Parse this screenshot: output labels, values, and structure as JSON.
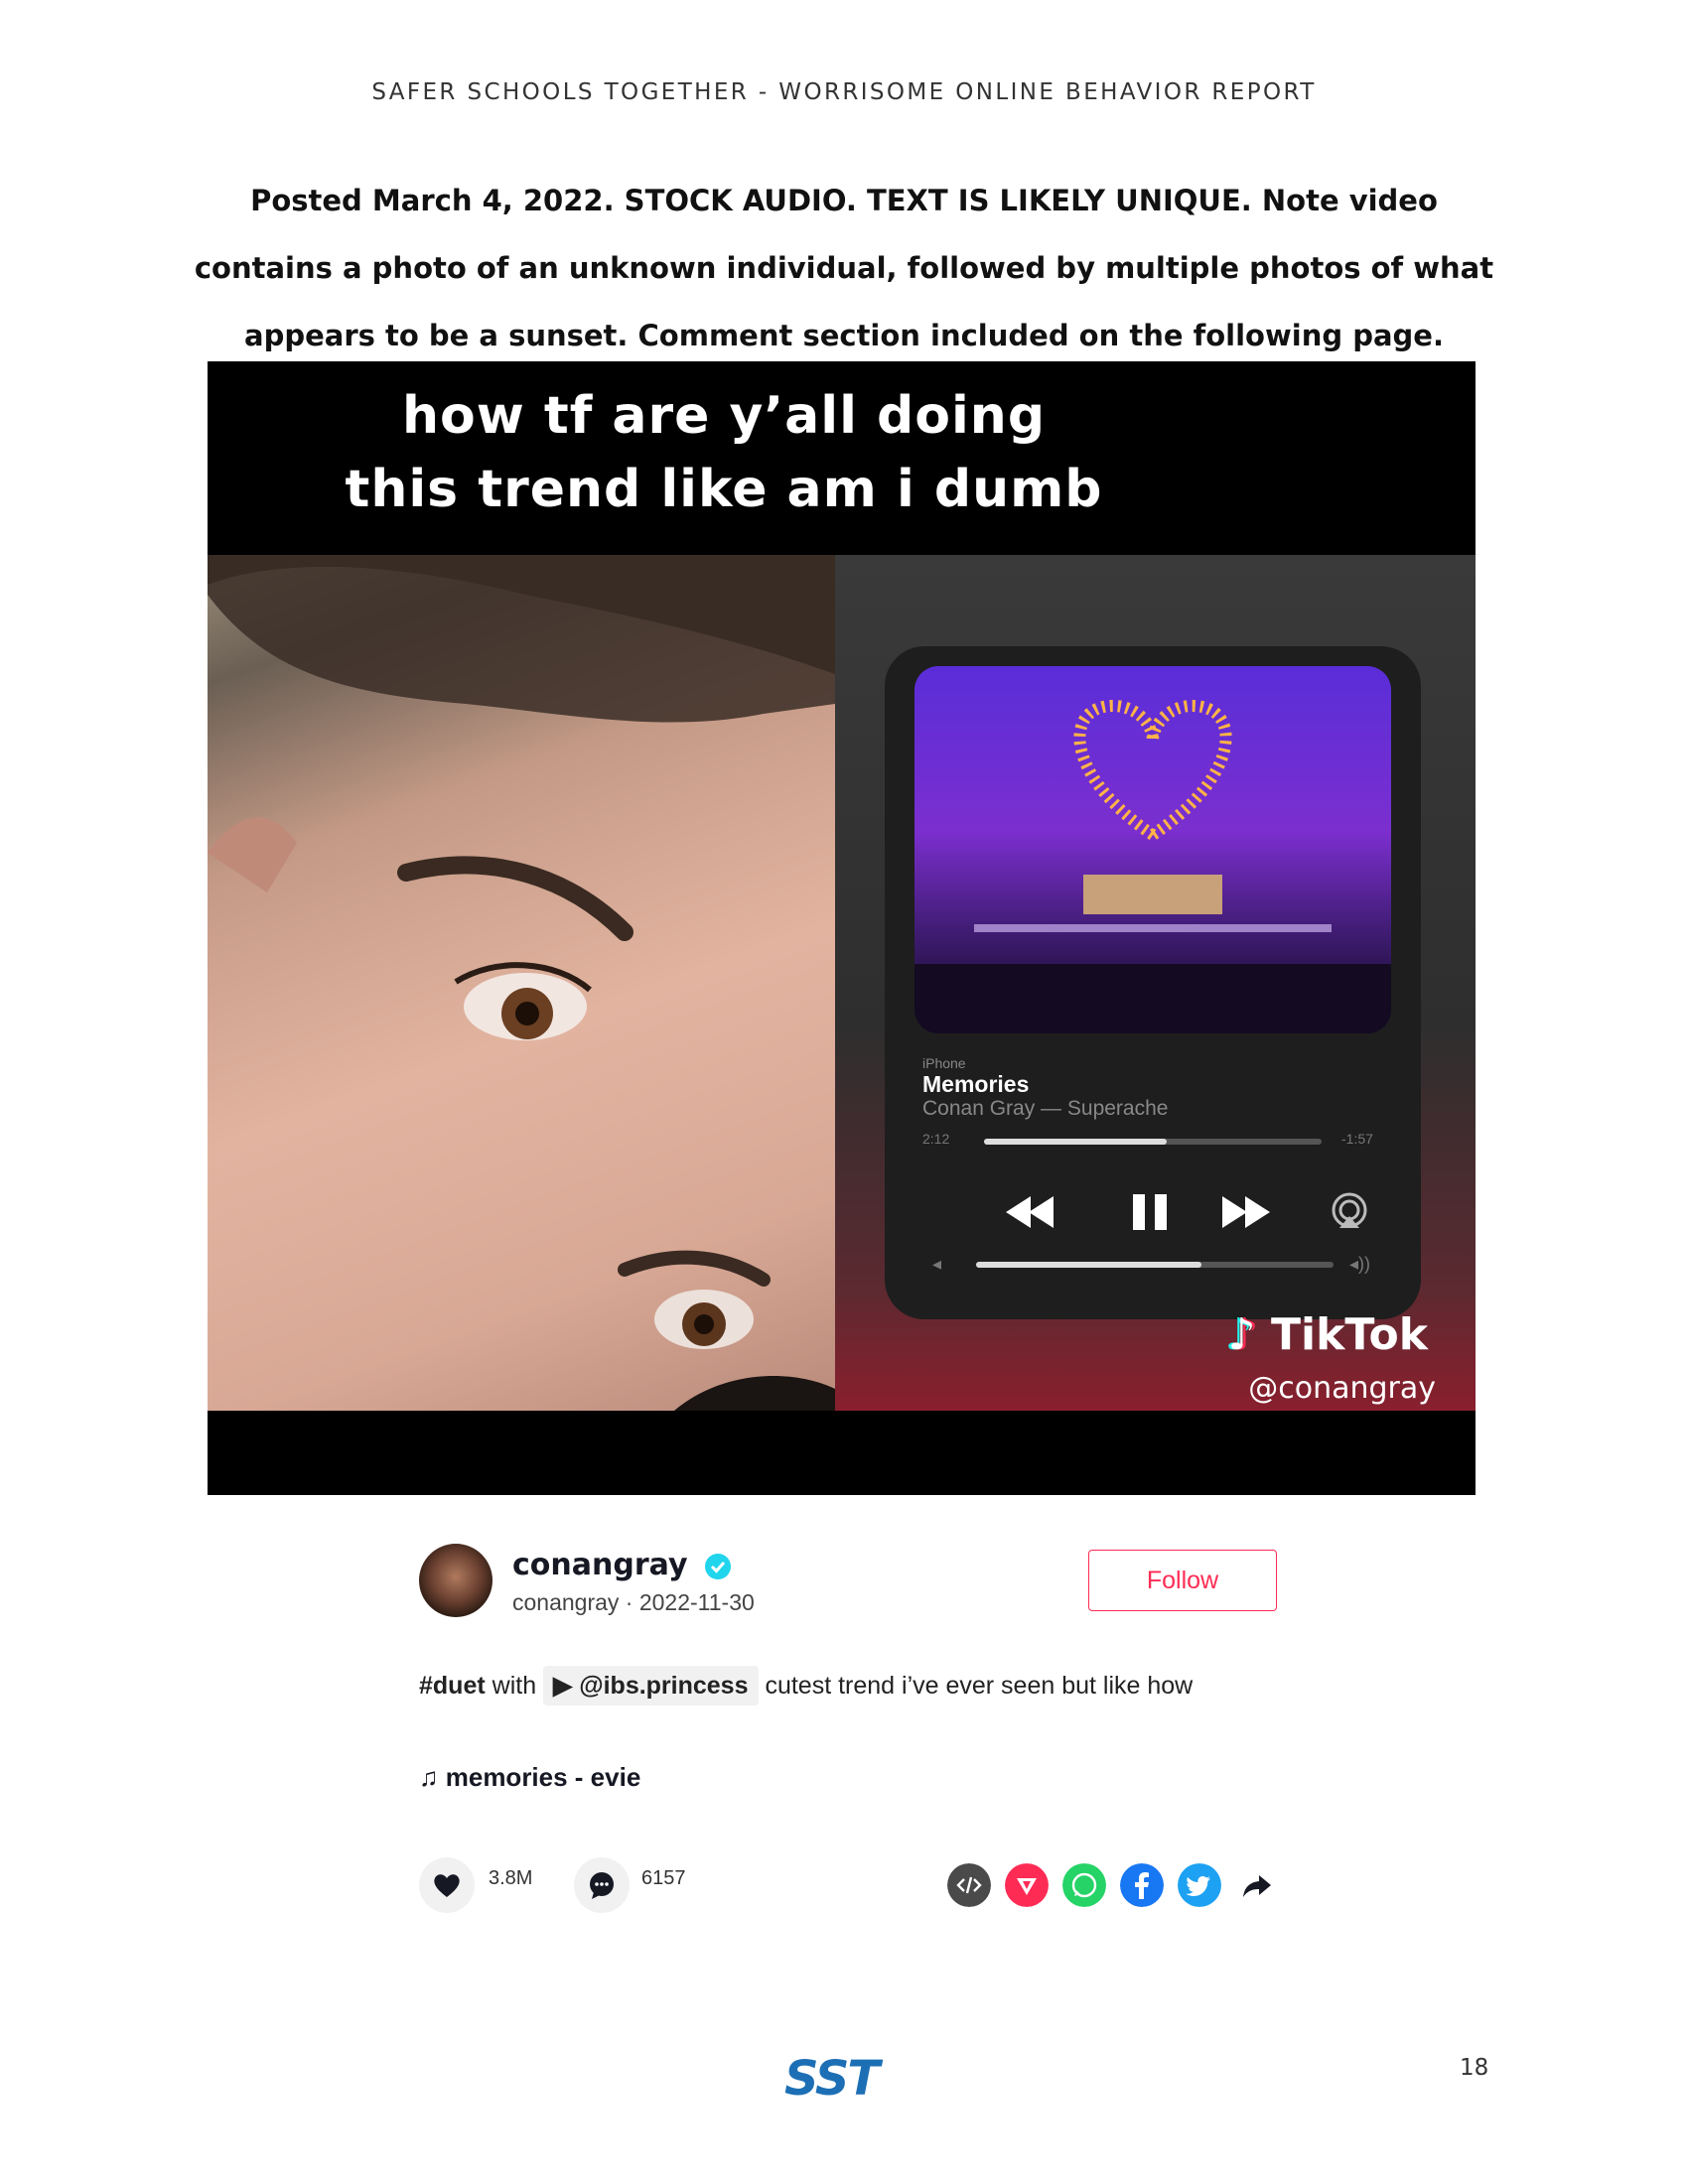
{
  "header": "SAFER SCHOOLS TOGETHER - WORRISOME ONLINE BEHAVIOR REPORT",
  "caption": "Posted March 4, 2022. STOCK AUDIO. TEXT IS LIKELY UNIQUE. Note video contains a photo of an unknown individual, followed by multiple photos of what appears to be a sunset. Comment section included on the following page.",
  "video": {
    "overlay_line1": "how tf are y’all doing",
    "overlay_line2": "this trend like am i dumb",
    "player": {
      "source": "iPhone",
      "title": "Memories",
      "artist": "Conan Gray — Superache",
      "elapsed": "2:12",
      "remaining": "-1:57",
      "progress": 0.54,
      "volume": 0.63
    },
    "watermark_logo": "TikTok",
    "watermark_handle": "@conangray"
  },
  "post": {
    "username": "conangray",
    "meta": "conangray · 2022-11-30",
    "follow_label": "Follow",
    "desc_hashtag": "#duet",
    "desc_with": " with ",
    "desc_mention": "@ibs.princess",
    "desc_text": " cutest trend i’ve ever seen but like how",
    "music": "memories - evie",
    "likes": "3.8M",
    "comments": "6157"
  },
  "colors": {
    "accent": "#fe2c55",
    "verified": "#20d5ec",
    "whatsapp": "#25d366",
    "facebook": "#1877f2",
    "twitter": "#1da1f2",
    "embed": "#4a4a4a",
    "send": "#fe2c55"
  },
  "footer": {
    "logo": "SST",
    "page_number": "18"
  }
}
